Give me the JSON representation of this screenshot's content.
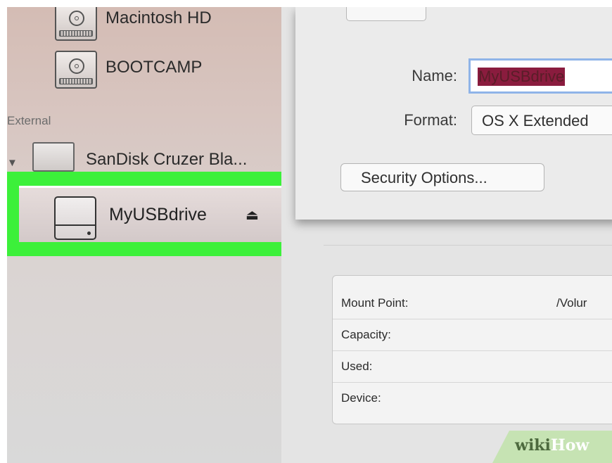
{
  "sidebar": {
    "internal_items": [
      {
        "label": "Macintosh HD",
        "icon": "hard-drive-icon"
      },
      {
        "label": "BOOTCAMP",
        "icon": "hard-drive-icon"
      }
    ],
    "external_section_label": "External",
    "external_device": {
      "label": "SanDisk Cruzer Bla...",
      "icon": "external-drive-icon",
      "expanded": true
    },
    "selected_volume": {
      "label": "MyUSBdrive",
      "icon": "usb-drive-icon",
      "eject_icon": "eject-icon",
      "highlight_color": "#3cf03a"
    }
  },
  "erase_dialog": {
    "name_label": "Name:",
    "name_value": "MyUSBdrive",
    "format_label": "Format:",
    "format_value": "OS X Extended",
    "security_options_label": "Security Options..."
  },
  "info_table": {
    "rows": [
      {
        "key": "Mount Point:",
        "value": "/Volur"
      },
      {
        "key": "Capacity:",
        "value": ""
      },
      {
        "key": "Used:",
        "value": ""
      },
      {
        "key": "Device:",
        "value": ""
      }
    ]
  },
  "watermark": {
    "wiki": "wiki",
    "how": "How"
  }
}
